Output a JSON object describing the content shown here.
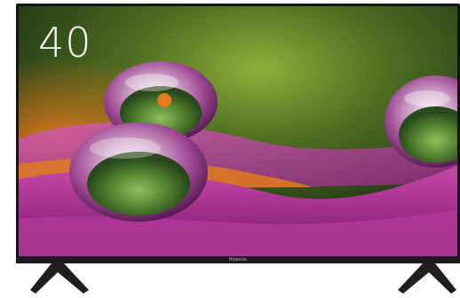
{
  "product": {
    "screen_size": "40",
    "brand": "Hisense"
  }
}
